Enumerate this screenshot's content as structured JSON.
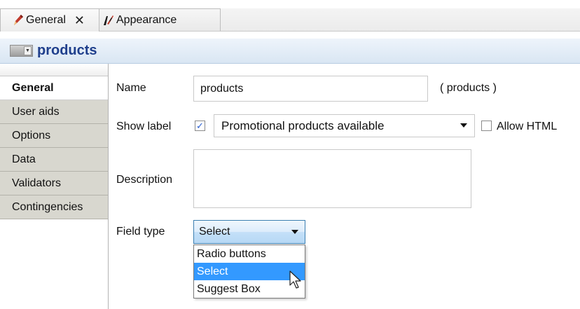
{
  "tabs": [
    {
      "label": "General",
      "close_label": "✕"
    },
    {
      "label": "Appearance"
    }
  ],
  "header": {
    "title": "products"
  },
  "nav": {
    "items": [
      {
        "label": "General",
        "active": true
      },
      {
        "label": "User aids"
      },
      {
        "label": "Options"
      },
      {
        "label": "Data"
      },
      {
        "label": "Validators"
      },
      {
        "label": "Contingencies"
      }
    ]
  },
  "form": {
    "name": {
      "label": "Name",
      "value": "products",
      "computed": "( products )"
    },
    "show_label": {
      "label": "Show label",
      "checked": true,
      "check_mark": "✓",
      "value": "Promotional products available"
    },
    "allow_html": {
      "label": "Allow HTML",
      "checked": false
    },
    "description": {
      "label": "Description",
      "value": ""
    },
    "field_type": {
      "label": "Field type",
      "value": "Select",
      "options": [
        "Radio buttons",
        "Select",
        "Suggest Box"
      ],
      "highlighted_option": "Select"
    }
  },
  "colors": {
    "header_title": "#1f3f8c",
    "selection": "#3399ff",
    "nav_bg": "#d8d7cf",
    "checkbox_mark": "#2a5fd1"
  },
  "icons": {
    "general_tab": "pencil-icon",
    "appearance_tab": "paintbrush-icon",
    "header": "dropdown-icon",
    "cursor": "mouse-pointer-icon"
  }
}
